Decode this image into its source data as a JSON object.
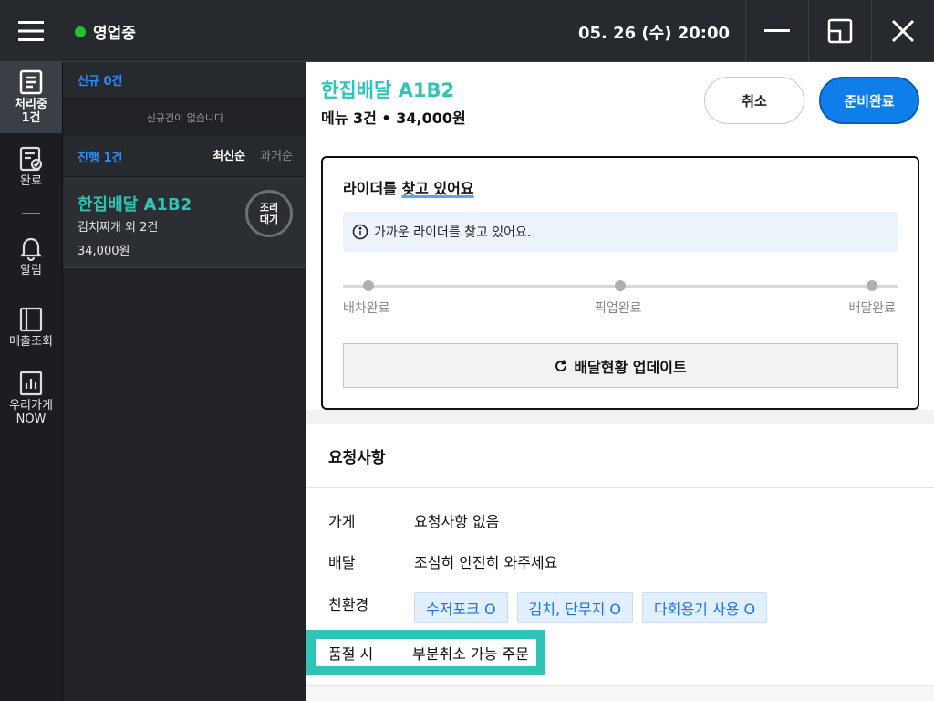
{
  "topbar": {
    "status_label": "영업중",
    "status_color": "#22c22e",
    "datetime": "05. 26 (수) 20:00",
    "icons": [
      "hamburger-icon",
      "minimize-icon",
      "restore-icon",
      "close-icon"
    ]
  },
  "nav": {
    "items": [
      {
        "label": "처리중\n1건",
        "icon": "clipboard-icon",
        "active": true
      },
      {
        "label": "완료",
        "icon": "checked-document-icon",
        "active": false
      },
      {
        "label": "알림",
        "icon": "bell-icon",
        "active": false
      },
      {
        "label": "매출조회",
        "icon": "ledger-icon",
        "active": false
      },
      {
        "label": "우리가게\nNOW",
        "icon": "bar-chart-icon",
        "active": false
      }
    ]
  },
  "list": {
    "new_header": "신규 0건",
    "new_empty": "신규건이 없습니다",
    "progress_header": "진행 1건",
    "sort_latest": "최신순",
    "sort_oldest": "과거순",
    "order": {
      "name": "한집배달 A1B2",
      "menu": "김치찌개 외 2건",
      "price": "34,000원",
      "badge": "조리\n대기"
    }
  },
  "detail": {
    "title": "한집배달 A1B2",
    "subtitle": "메뉴 3건 • 34,000원",
    "cancel_label": "취소",
    "ready_label": "준비완료",
    "rider": {
      "title_pre": "라이더를 ",
      "title_hl": "찾고 있어요",
      "info": "가까운 라이더를 찾고 있어요.",
      "steps": [
        "배차완료",
        "픽업완료",
        "배달완료"
      ],
      "update_label": "배달현황 업데이트"
    },
    "requests": {
      "header": "요청사항",
      "store_key": "가게",
      "store_val": "요청사항 없음",
      "delivery_key": "배달",
      "delivery_val": "조심히 안전히 와주세요",
      "eco_key": "친환경",
      "eco_tags": [
        "수저포크 O",
        "김치, 단무지 O",
        "다회용기 사용 O"
      ],
      "soldout_key": "품절 시",
      "soldout_val": "부분취소 가능 주문"
    }
  },
  "colors": {
    "accent_teal": "#2ec4b6",
    "primary_blue": "#0f7eea",
    "dark_bg": "#26292d"
  }
}
